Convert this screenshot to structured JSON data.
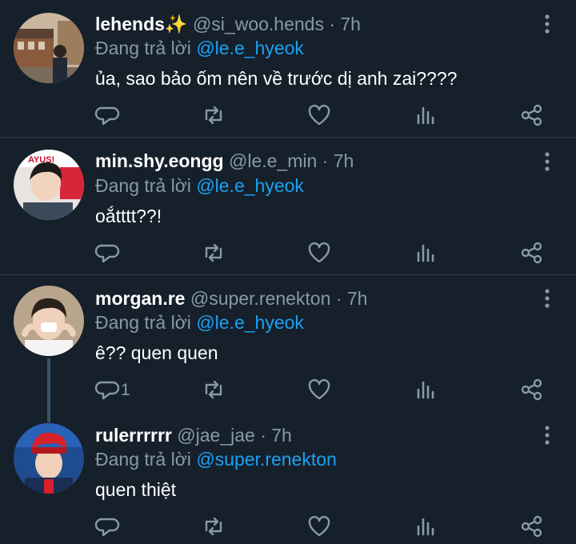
{
  "colors": {
    "background": "#15202b",
    "divider": "#38444d",
    "muted": "#8899a6",
    "mention": "#1da1f2",
    "thread_line": "#3d5466"
  },
  "tweets": [
    {
      "name": "lehends✨",
      "handle": "@si_woo.hends",
      "time": "· 7h",
      "replying_prefix": "Đang trả lời",
      "replying_to": "@le.e_hyeok",
      "text": "ủa, sao bảo ốm nên về trước dị anh zai????",
      "reply_count": ""
    },
    {
      "name": "min.shy.eongg",
      "handle": "@le.e_min",
      "time": "· 7h",
      "replying_prefix": "Đang trả lời",
      "replying_to": "@le.e_hyeok",
      "text": "oắtttt??!",
      "reply_count": "",
      "avatar_badge": "AYUS!"
    },
    {
      "name": "morgan.re",
      "handle": "@super.renekton",
      "time": "· 7h",
      "replying_prefix": "Đang trả lời",
      "replying_to": "@le.e_hyeok",
      "text": "ê?? quen quen",
      "reply_count": "1"
    },
    {
      "name": "rulerrrrrr",
      "handle": "@jae_jae",
      "time": "· 7h",
      "replying_prefix": "Đang trả lời",
      "replying_to": "@super.renekton",
      "text": "quen thiệt",
      "reply_count": ""
    }
  ],
  "icons": {
    "reply": "reply-icon",
    "retweet": "retweet-icon",
    "like": "heart-icon",
    "analytics": "analytics-icon",
    "share": "share-icon",
    "more": "more-vertical-icon"
  }
}
